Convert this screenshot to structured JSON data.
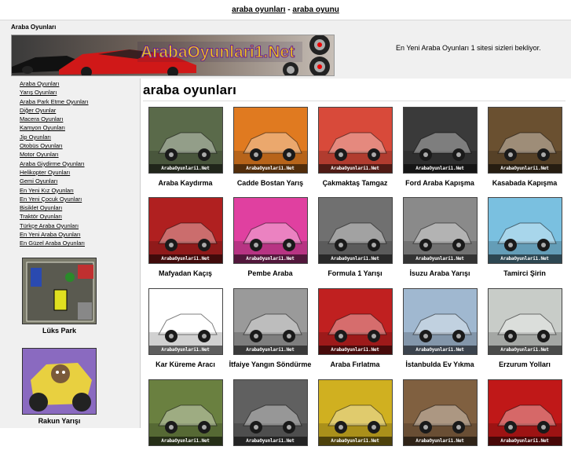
{
  "topbar": {
    "link1": "araba oyunları",
    "sep": " - ",
    "link2": "araba oyunu"
  },
  "header": {
    "site_title": "Araba Oyunları",
    "banner_logo": "ArabaOyunlari1.Net",
    "tagline": "En Yeni Araba Oyunları 1 sitesi sizleri bekliyor."
  },
  "sidebar": {
    "links": [
      "Araba Oyunları",
      "Yarış Oyunları",
      "Araba Park Etme Oyunları",
      "Diğer Oyunlar",
      "Macera Oyunları",
      "Kamyon Oyunları",
      "Jip Oyunları",
      "Otobüs Oyunları",
      "Motor Oyunları",
      "Araba Giydirme Oyunları",
      "Helikopter Oyunları",
      "Gemi Oyunları",
      "En Yeni Kız Oyunları",
      "En Yeni Çocuk Oyunları",
      "Bisiklet Oyunları",
      "Traktör Oyunları",
      "Türkçe Araba Oyunları",
      "En Yeni Araba Oyunları",
      "En Güzel Araba Oyunları"
    ],
    "featured": [
      {
        "label": "Lüks Park"
      },
      {
        "label": "Rakun Yarışı"
      }
    ]
  },
  "main": {
    "title": "araba oyunları",
    "watermark": "ArabaOyunlari1.Net",
    "tiles": [
      {
        "label": "Araba Kaydırma"
      },
      {
        "label": "Cadde Bostan Yarış"
      },
      {
        "label": "Çakmaktaş Tamgaz"
      },
      {
        "label": "Ford Araba Kapışma"
      },
      {
        "label": "Kasabada Kapışma"
      },
      {
        "label": "Mafyadan Kaçış"
      },
      {
        "label": "Pembe Araba"
      },
      {
        "label": "Formula 1 Yarışı"
      },
      {
        "label": "İsuzu Araba Yarışı"
      },
      {
        "label": "Tamirci Şirin"
      },
      {
        "label": "Kar Küreme Aracı"
      },
      {
        "label": "İtfaiye Yangın Söndürme"
      },
      {
        "label": "Araba Fırlatma"
      },
      {
        "label": "İstanbulda Ev Yıkma"
      },
      {
        "label": "Erzurum Yolları"
      },
      {
        "label": ""
      },
      {
        "label": ""
      },
      {
        "label": ""
      },
      {
        "label": ""
      },
      {
        "label": ""
      }
    ],
    "thumb_colors": [
      "#5a6a4a",
      "#e07a20",
      "#d84a3a",
      "#3a3a3a",
      "#6a5030",
      "#b02020",
      "#e040a0",
      "#707070",
      "#8a8a8a",
      "#7ac0e0",
      "#ffffff",
      "#9a9a9a",
      "#c02020",
      "#a0b8d0",
      "#c8ccc8",
      "#6a8040",
      "#606060",
      "#d0b020",
      "#806040",
      "#c01818"
    ]
  }
}
